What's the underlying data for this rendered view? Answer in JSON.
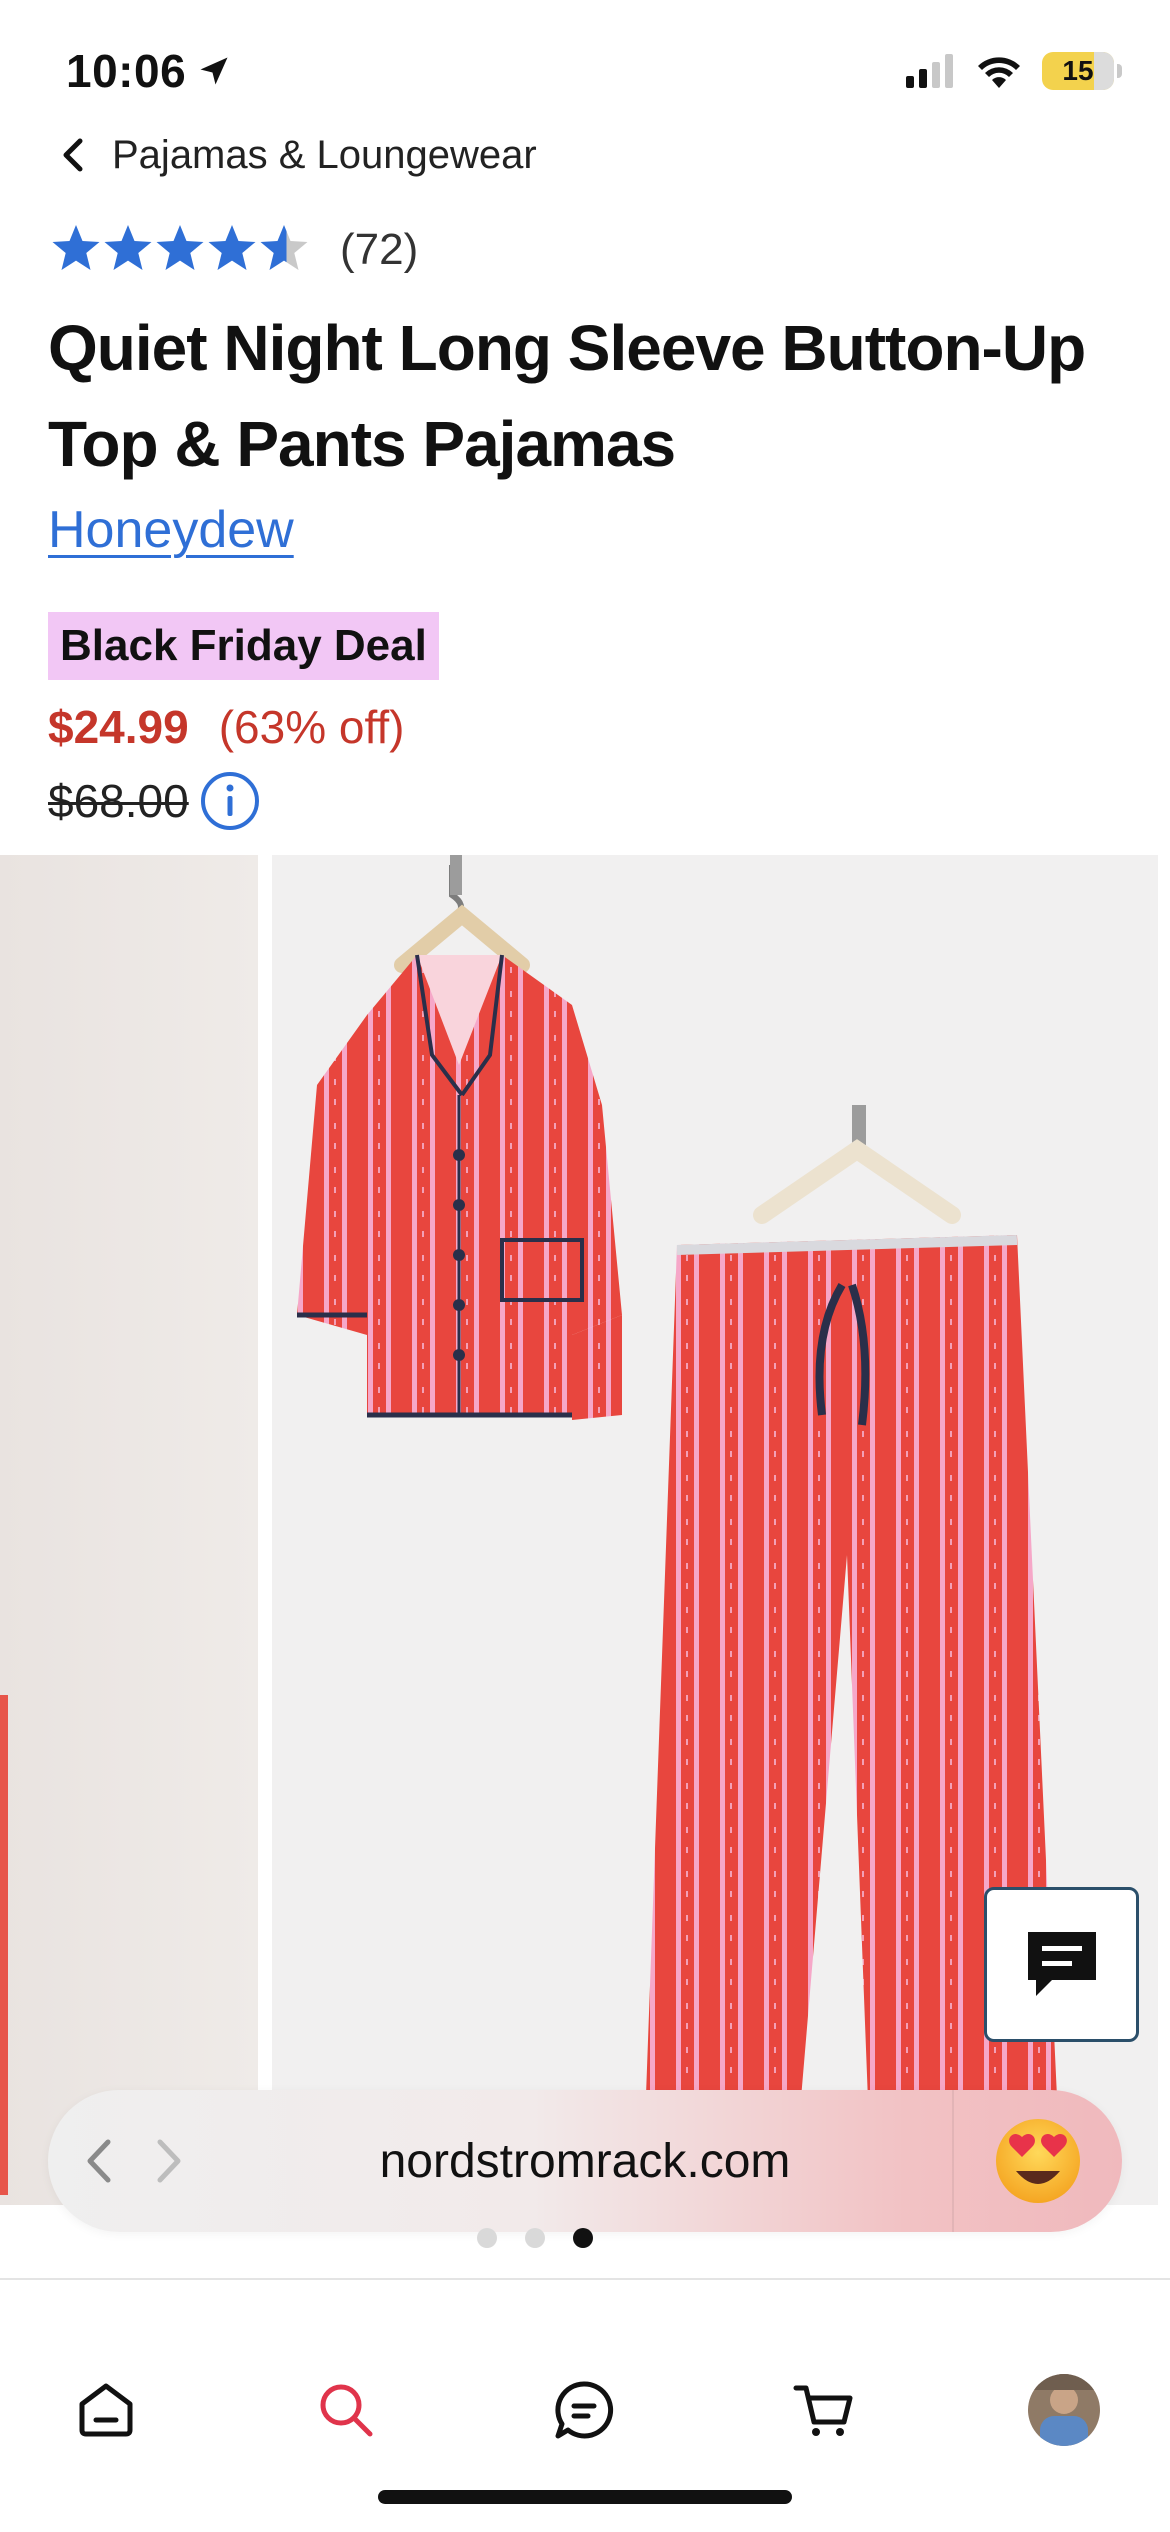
{
  "status": {
    "time": "10:06",
    "battery": "15",
    "icons": [
      "location-arrow-icon",
      "cellular-signal-icon",
      "wifi-icon",
      "battery-icon"
    ]
  },
  "breadcrumb": {
    "back_icon": "chevron-left-icon",
    "label": "Pajamas & Loungewear"
  },
  "product": {
    "rating": {
      "stars": 4.5,
      "max": 5,
      "count": "(72)",
      "color": "#2f6fd6"
    },
    "title": "Quiet Night Long Sleeve Button-Up Top & Pants Pajamas",
    "brand": "Honeydew",
    "deal_badge": "Black Friday Deal",
    "sale_price": "$24.99",
    "discount": "(63% off)",
    "original_price": "$68.00",
    "info_icon": "info-icon"
  },
  "carousel": {
    "total_images": 3,
    "active_index": 2
  },
  "chat": {
    "icon": "chat-icon"
  },
  "browser": {
    "url": "nordstromrack.com",
    "back_icon": "chevron-left-icon",
    "forward_icon": "chevron-right-icon",
    "extension_icon": "heart-eyes-emoji-icon"
  },
  "tabbar": {
    "items": [
      {
        "name": "home",
        "icon": "home-icon",
        "active": false
      },
      {
        "name": "search",
        "icon": "search-icon",
        "active": true
      },
      {
        "name": "messages",
        "icon": "chat-bubble-icon",
        "active": false
      },
      {
        "name": "cart",
        "icon": "cart-icon",
        "active": false
      },
      {
        "name": "profile",
        "icon": "avatar-icon",
        "active": false
      }
    ],
    "active_color": "#e0344b"
  },
  "colors": {
    "sale": "#c5362a",
    "link": "#2f6fd6",
    "deal_bg": "#f2c7f5",
    "pajama_red": "#e8463e"
  }
}
